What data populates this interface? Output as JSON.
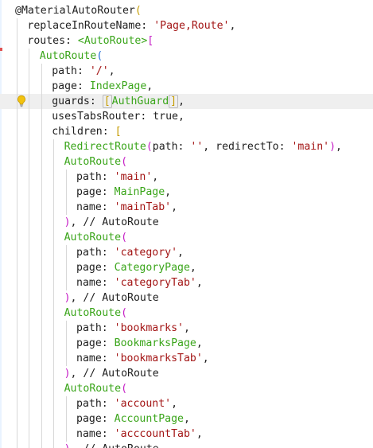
{
  "editor": {
    "lines": [
      [
        {
          "t": "@MaterialAutoRouter",
          "c": "tok-attr"
        },
        {
          "t": "(",
          "c": "tok-bracket-y"
        }
      ],
      [
        {
          "t": "replaceInRouteName: ",
          "c": "tok-plain"
        },
        {
          "t": "'Page,Route'",
          "c": "tok-string"
        },
        {
          "t": ",",
          "c": "tok-plain"
        }
      ],
      [
        {
          "t": "routes: ",
          "c": "tok-plain"
        },
        {
          "t": "<AutoRoute>",
          "c": "tok-ctor"
        },
        {
          "t": "[",
          "c": "tok-bracket-p"
        }
      ],
      [
        {
          "t": "AutoRoute",
          "c": "tok-ctor"
        },
        {
          "t": "(",
          "c": "tok-bracket-b"
        }
      ],
      [
        {
          "t": "path: ",
          "c": "tok-plain"
        },
        {
          "t": "'/'",
          "c": "tok-string"
        },
        {
          "t": ",",
          "c": "tok-plain"
        }
      ],
      [
        {
          "t": "page: ",
          "c": "tok-plain"
        },
        {
          "t": "IndexPage",
          "c": "tok-ctor"
        },
        {
          "t": ",",
          "c": "tok-plain"
        }
      ],
      [
        {
          "t": "guards: ",
          "c": "tok-plain"
        },
        {
          "t": "[",
          "c": "tok-bracket-y tok-boxed"
        },
        {
          "t": "AuthGuard",
          "c": "tok-ctor"
        },
        {
          "t": "]",
          "c": "tok-bracket-y tok-boxed"
        },
        {
          "t": ",",
          "c": "tok-plain"
        }
      ],
      [
        {
          "t": "usesTabsRouter: ",
          "c": "tok-plain"
        },
        {
          "t": "true",
          "c": "tok-keyword"
        },
        {
          "t": ",",
          "c": "tok-plain"
        }
      ],
      [
        {
          "t": "children: ",
          "c": "tok-plain"
        },
        {
          "t": "[",
          "c": "tok-bracket-y"
        }
      ],
      [
        {
          "t": "RedirectRoute",
          "c": "tok-ctor"
        },
        {
          "t": "(",
          "c": "tok-bracket-p"
        },
        {
          "t": "path: ",
          "c": "tok-plain"
        },
        {
          "t": "''",
          "c": "tok-string"
        },
        {
          "t": ", redirectTo: ",
          "c": "tok-plain"
        },
        {
          "t": "'main'",
          "c": "tok-string"
        },
        {
          "t": ")",
          "c": "tok-bracket-p"
        },
        {
          "t": ",",
          "c": "tok-plain"
        }
      ],
      [
        {
          "t": "AutoRoute",
          "c": "tok-ctor"
        },
        {
          "t": "(",
          "c": "tok-bracket-p"
        }
      ],
      [
        {
          "t": "path: ",
          "c": "tok-plain"
        },
        {
          "t": "'main'",
          "c": "tok-string"
        },
        {
          "t": ",",
          "c": "tok-plain"
        }
      ],
      [
        {
          "t": "page: ",
          "c": "tok-plain"
        },
        {
          "t": "MainPage",
          "c": "tok-ctor"
        },
        {
          "t": ",",
          "c": "tok-plain"
        }
      ],
      [
        {
          "t": "name: ",
          "c": "tok-plain"
        },
        {
          "t": "'mainTab'",
          "c": "tok-string"
        },
        {
          "t": ",",
          "c": "tok-plain"
        }
      ],
      [
        {
          "t": ")",
          "c": "tok-bracket-p"
        },
        {
          "t": ", // AutoRoute",
          "c": "tok-comment"
        }
      ],
      [
        {
          "t": "AutoRoute",
          "c": "tok-ctor"
        },
        {
          "t": "(",
          "c": "tok-bracket-p"
        }
      ],
      [
        {
          "t": "path: ",
          "c": "tok-plain"
        },
        {
          "t": "'category'",
          "c": "tok-string"
        },
        {
          "t": ",",
          "c": "tok-plain"
        }
      ],
      [
        {
          "t": "page: ",
          "c": "tok-plain"
        },
        {
          "t": "CategoryPage",
          "c": "tok-ctor"
        },
        {
          "t": ",",
          "c": "tok-plain"
        }
      ],
      [
        {
          "t": "name: ",
          "c": "tok-plain"
        },
        {
          "t": "'categoryTab'",
          "c": "tok-string"
        },
        {
          "t": ",",
          "c": "tok-plain"
        }
      ],
      [
        {
          "t": ")",
          "c": "tok-bracket-p"
        },
        {
          "t": ", // AutoRoute",
          "c": "tok-comment"
        }
      ],
      [
        {
          "t": "AutoRoute",
          "c": "tok-ctor"
        },
        {
          "t": "(",
          "c": "tok-bracket-p"
        }
      ],
      [
        {
          "t": "path: ",
          "c": "tok-plain"
        },
        {
          "t": "'bookmarks'",
          "c": "tok-string"
        },
        {
          "t": ",",
          "c": "tok-plain"
        }
      ],
      [
        {
          "t": "page: ",
          "c": "tok-plain"
        },
        {
          "t": "BookmarksPage",
          "c": "tok-ctor"
        },
        {
          "t": ",",
          "c": "tok-plain"
        }
      ],
      [
        {
          "t": "name: ",
          "c": "tok-plain"
        },
        {
          "t": "'bookmarksTab'",
          "c": "tok-string"
        },
        {
          "t": ",",
          "c": "tok-plain"
        }
      ],
      [
        {
          "t": ")",
          "c": "tok-bracket-p"
        },
        {
          "t": ", // AutoRoute",
          "c": "tok-comment"
        }
      ],
      [
        {
          "t": "AutoRoute",
          "c": "tok-ctor"
        },
        {
          "t": "(",
          "c": "tok-bracket-p"
        }
      ],
      [
        {
          "t": "path: ",
          "c": "tok-plain"
        },
        {
          "t": "'account'",
          "c": "tok-string"
        },
        {
          "t": ",",
          "c": "tok-plain"
        }
      ],
      [
        {
          "t": "page: ",
          "c": "tok-plain"
        },
        {
          "t": "AccountPage",
          "c": "tok-ctor"
        },
        {
          "t": ",",
          "c": "tok-plain"
        }
      ],
      [
        {
          "t": "name: ",
          "c": "tok-plain"
        },
        {
          "t": "'acccountTab'",
          "c": "tok-string"
        },
        {
          "t": ",",
          "c": "tok-plain"
        }
      ],
      [
        {
          "t": ")",
          "c": "tok-bracket-p"
        },
        {
          "t": ", // AutoRoute",
          "c": "tok-comment"
        }
      ]
    ],
    "highlighted_line": 6,
    "lightbulb_icon": "lightbulb-icon",
    "colors": {
      "string": "#a31515",
      "type": "#3aa51a",
      "bracket_yellow": "#c59c00",
      "bracket_purple": "#c51cc5",
      "bracket_blue": "#1f6bd6",
      "line_highlight": "#efefef"
    }
  }
}
